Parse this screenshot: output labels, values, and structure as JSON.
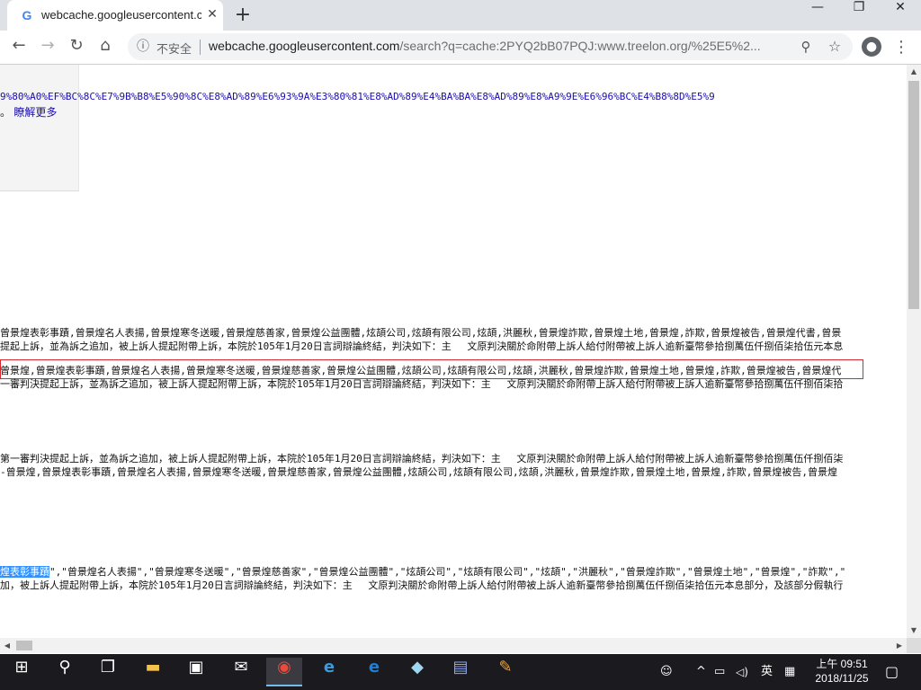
{
  "window": {
    "tab_title": "webcache.googleusercontent.c",
    "favicon": "G",
    "close_tab": "✕",
    "new_tab": "+",
    "minimize": "—",
    "maximize": "❐",
    "close": "✕"
  },
  "toolbar": {
    "back": "←",
    "forward": "→",
    "reload": "↻",
    "home": "⌂",
    "info": "ⓘ",
    "insecure_label": "不安全",
    "url_host": "webcache.googleusercontent.com",
    "url_rest": "/search?q=cache:2PYQ2bB07PQJ:www.treelon.org/%25E5%2...",
    "zoom": "⚲",
    "star": "☆",
    "profile": "●",
    "menu": "⋮"
  },
  "page": {
    "cache_url": "9%80%A0%EF%BC%8C%E7%9B%B8%E5%90%8C%E8%AD%89%E6%93%9A%E3%80%81%E8%AD%89%E4%BA%BA%E8%AD%89%E8%A9%9E%E6%96%BC%E4%B8%8D%E5%9",
    "learn_more_prefix": "。",
    "learn_more": "瞭解更多",
    "lines": [
      "曾景煌表彰事蹟,曾景煌名人表揚,曾景煌寒冬送暖,曾景煌慈善家,曾景煌公益團體,炫頡公司,炫頡有限公司,炫頡,洪麗秋,曾景煌詐欺,曾景煌土地,曾景煌,詐欺,曾景煌被告,曾景煌代書,曾景",
      "提起上訴，並為訴之追加，被上訴人提起附帶上訴，本院於105年1月20日言詞辯論終結，判決如下：主　 文原判決關於命附帶上訴人給付附帶被上訴人逾新臺幣參拾捌萬伍仟捌佰柒拾伍元本息",
      "曾景煌,曾景煌表彰事蹟,曾景煌名人表揚,曾景煌寒冬送暖,曾景煌慈善家,曾景煌公益團體,炫頡公司,炫頡有限公司,炫頡,洪麗秋,曾景煌詐欺,曾景煌土地,曾景煌,詐欺,曾景煌被告,曾景煌代",
      "一審判決提起上訴，並為訴之追加，被上訴人提起附帶上訴，本院於105年1月20日言詞辯論終結，判決如下：主　 文原判決關於命附帶上訴人給付附帶被上訴人逾新臺幣參拾捌萬伍仟捌佰柒拾",
      "第一審判決提起上訴，並為訴之追加，被上訴人提起附帶上訴，本院於105年1月20日言詞辯論終結，判決如下：主　 文原判決關於命附帶上訴人給付附帶被上訴人逾新臺幣參拾捌萬伍仟捌佰柒",
      "-曾景煌,曾景煌表彰事蹟,曾景煌名人表揚,曾景煌寒冬送暖,曾景煌慈善家,曾景煌公益團體,炫頡公司,炫頡有限公司,炫頡,洪麗秋,曾景煌詐欺,曾景煌土地,曾景煌,詐欺,曾景煌被告,曾景煌",
      "加，被上訴人提起附帶上訴，本院於105年1月20日言詞辯論終結，判決如下：主　 文原判決關於命附帶上訴人給付附帶被上訴人逾新臺幣參拾捌萬伍仟捌佰柒拾伍元本息部分，及該部分假執行"
    ],
    "highlight_text": "煌表彰事蹟",
    "highlight_rest": "\",\"曾景煌名人表揚\",\"曾景煌寒冬送暖\",\"曾景煌慈善家\",\"曾景煌公益團體\",\"炫頡公司\",\"炫頡有限公司\",\"炫頡\",\"洪麗秋\",\"曾景煌詐欺\",\"曾景煌土地\",\"曾景煌\",\"詐欺\",\""
  },
  "taskbar": {
    "start": "⊞",
    "search": "⚲",
    "taskview": "❐",
    "explorer": "▬",
    "store": "▣",
    "mail": "✉",
    "chrome": "◉",
    "ie": "e",
    "edge": "e",
    "app1": "◆",
    "app2": "▤",
    "paint": "✎",
    "people": "☺",
    "chevron": "^",
    "network": "▭",
    "volume": "◁)",
    "ime": "英",
    "notif_ime": "▦",
    "time": "上午 09:51",
    "date": "2018/11/25",
    "action_center": "▢"
  }
}
